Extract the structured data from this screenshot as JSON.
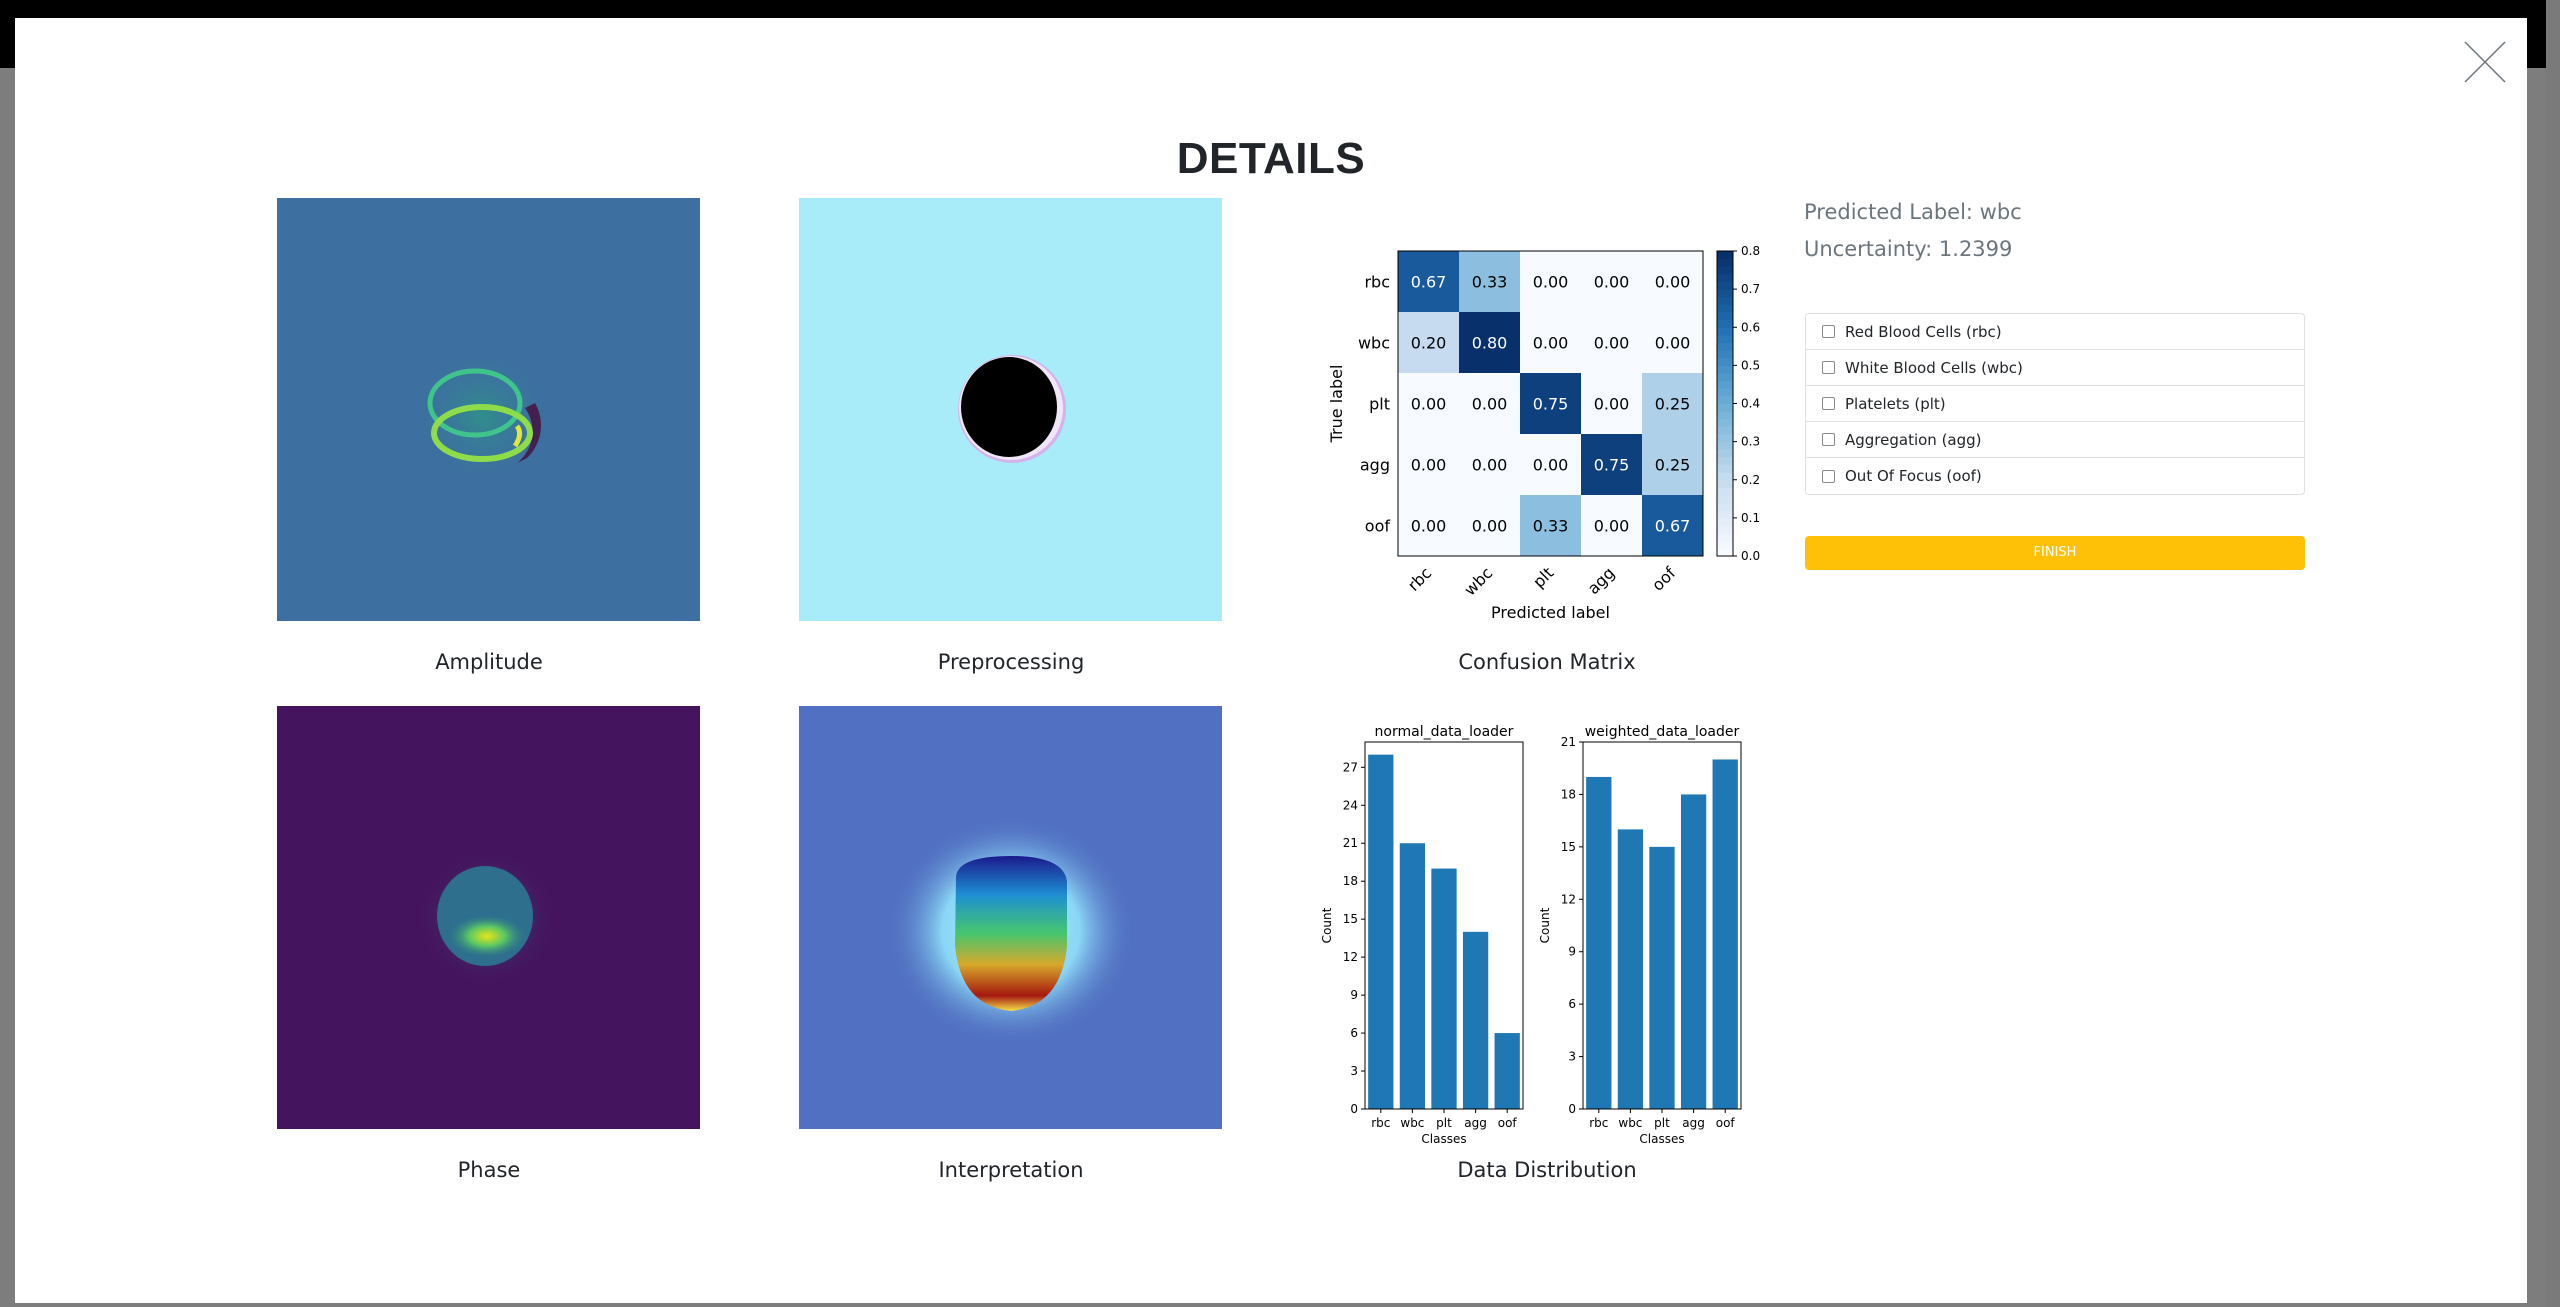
{
  "modal": {
    "title": "DETAILS",
    "close_icon": "close-icon"
  },
  "images": [
    {
      "key": "amplitude",
      "caption": "Amplitude"
    },
    {
      "key": "preprocessing",
      "caption": "Preprocessing"
    },
    {
      "key": "confusion",
      "caption": "Confusion Matrix"
    },
    {
      "key": "phase",
      "caption": "Phase"
    },
    {
      "key": "interpretation",
      "caption": "Interpretation"
    },
    {
      "key": "distribution",
      "caption": "Data Distribution"
    }
  ],
  "prediction": {
    "predicted_label_text": "Predicted Label: wbc",
    "uncertainty_text": "Uncertainty: 1.2399"
  },
  "classes": [
    {
      "label": "Red Blood Cells (rbc)",
      "checked": false
    },
    {
      "label": "White Blood Cells (wbc)",
      "checked": false
    },
    {
      "label": "Platelets (plt)",
      "checked": false
    },
    {
      "label": "Aggregation (agg)",
      "checked": false
    },
    {
      "label": "Out Of Focus (oof)",
      "checked": false
    }
  ],
  "finish_label": "FINISH",
  "colors": {
    "finish": "#ffc107",
    "bar": "#1f77b4",
    "amplitude_bg": "#3d6fa0",
    "preprocessing_bg": "#a8ecfa",
    "phase_bg": "#45145e",
    "interpretation_bg": "#5170c2"
  },
  "chart_data": [
    {
      "type": "heatmap",
      "title": "",
      "xlabel": "Predicted label",
      "ylabel": "True label",
      "x_categories": [
        "rbc",
        "wbc",
        "plt",
        "agg",
        "oof"
      ],
      "y_categories": [
        "rbc",
        "wbc",
        "plt",
        "agg",
        "oof"
      ],
      "values": [
        [
          0.67,
          0.33,
          0.0,
          0.0,
          0.0
        ],
        [
          0.2,
          0.8,
          0.0,
          0.0,
          0.0
        ],
        [
          0.0,
          0.0,
          0.75,
          0.0,
          0.25
        ],
        [
          0.0,
          0.0,
          0.0,
          0.75,
          0.25
        ],
        [
          0.0,
          0.0,
          0.33,
          0.0,
          0.67
        ]
      ],
      "colorbar_ticks": [
        "0.0",
        "0.1",
        "0.2",
        "0.3",
        "0.4",
        "0.5",
        "0.6",
        "0.7",
        "0.8"
      ],
      "colorbar_range": [
        0,
        0.8
      ]
    },
    {
      "type": "bar",
      "title": "normal_data_loader",
      "xlabel": "Classes",
      "ylabel": "Count",
      "categories": [
        "rbc",
        "wbc",
        "plt",
        "agg",
        "oof"
      ],
      "values": [
        28,
        21,
        19,
        14,
        6
      ],
      "ylim": [
        0,
        29
      ],
      "yticks": [
        0,
        3,
        6,
        9,
        12,
        15,
        18,
        21,
        24,
        27
      ]
    },
    {
      "type": "bar",
      "title": "weighted_data_loader",
      "xlabel": "Classes",
      "ylabel": "Count",
      "categories": [
        "rbc",
        "wbc",
        "plt",
        "agg",
        "oof"
      ],
      "values": [
        19,
        16,
        15,
        18,
        20
      ],
      "ylim": [
        0,
        21
      ],
      "yticks": [
        0,
        3,
        6,
        9,
        12,
        15,
        18,
        21
      ]
    }
  ]
}
